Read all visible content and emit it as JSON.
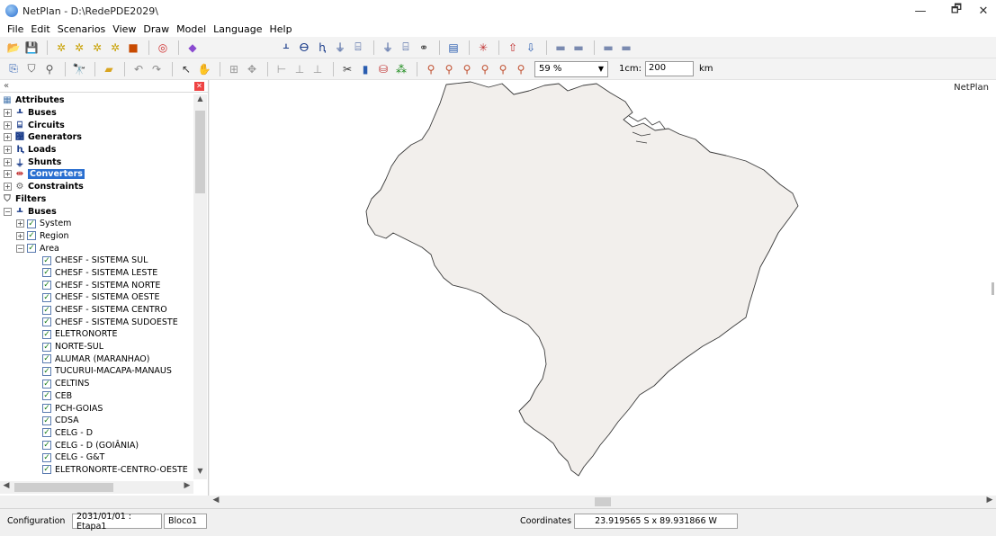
{
  "window": {
    "title": "NetPlan - D:\\RedePDE2029\\",
    "minimize": "—",
    "maximize": "🗗",
    "close": "✕"
  },
  "menu": [
    "File",
    "Edit",
    "Scenarios",
    "View",
    "Draw",
    "Model",
    "Language",
    "Help"
  ],
  "toolbar2": {
    "zoom_value": "59 %",
    "scale_label": "1cm:",
    "scale_value": "200",
    "scale_unit": "km"
  },
  "panel": {
    "collapse": "«"
  },
  "tree": {
    "attributes": "Attributes",
    "attr_items": [
      "Buses",
      "Circuits",
      "Generators",
      "Loads",
      "Shunts",
      "Converters",
      "Constraints"
    ],
    "filters": "Filters",
    "filter_buses": "Buses",
    "system": "System",
    "region": "Region",
    "area": "Area",
    "areas": [
      "CHESF - SISTEMA SUL",
      "CHESF - SISTEMA LESTE",
      "CHESF - SISTEMA NORTE",
      "CHESF - SISTEMA OESTE",
      "CHESF - SISTEMA CENTRO",
      "CHESF - SISTEMA SUDOESTE",
      "ELETRONORTE",
      "NORTE-SUL",
      "ALUMAR (MARANHAO)",
      "TUCURUI-MACAPA-MANAUS",
      "CELTINS",
      "CEB",
      "PCH-GOIAS",
      "CDSA",
      "CELG - D",
      "CELG - D (GOIÂNIA)",
      "CELG - G&T",
      "ELETRONORTE-CENTRO-OESTE"
    ]
  },
  "map": {
    "label": "NetPlan"
  },
  "status": {
    "config_label": "Configuration",
    "config_value": "2031/01/01 : Etapa1",
    "block_value": "Bloco1",
    "coords_label": "Coordinates",
    "coords_value": "23.919565 S x 89.931866 W"
  }
}
